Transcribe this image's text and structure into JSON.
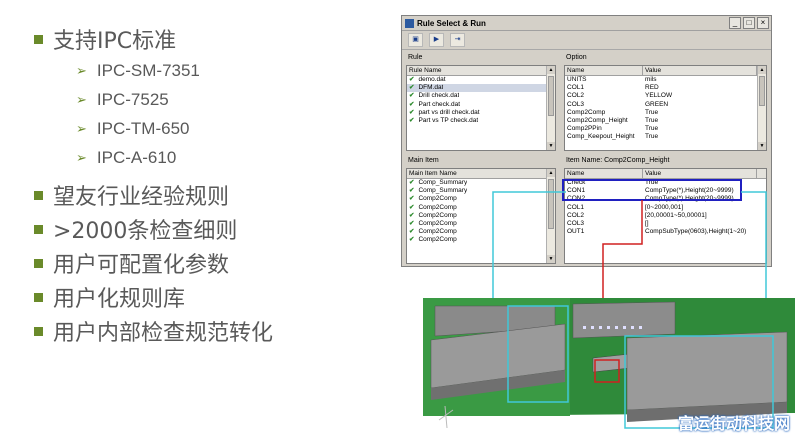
{
  "bullets": {
    "items": [
      {
        "text": "支持IPC标准",
        "sub": [
          "IPC-SM-7351",
          "IPC-7525",
          "IPC-TM-650",
          "IPC-A-610"
        ]
      },
      {
        "text": "望友行业经验规则"
      },
      {
        "text": ">2000条检查细则"
      },
      {
        "text": "用户可配置化参数"
      },
      {
        "text": "用户化规则库"
      },
      {
        "text": "用户内部检查规范转化"
      }
    ]
  },
  "window": {
    "title": "Rule Select & Run",
    "controls": {
      "minimize": "_",
      "maximize": "□",
      "close": "×"
    },
    "rule_panel": {
      "label": "Rule",
      "header": "Rule Name",
      "rows": [
        "demo.dat",
        "DFM.dat",
        "Drill check.dat",
        "Part check.dat",
        "part vs drill check.dat",
        "Part vs TP check.dat"
      ]
    },
    "option_panel": {
      "label": "Option",
      "headers": [
        "Name",
        "Value"
      ],
      "rows": [
        [
          "UNITS",
          "mils"
        ],
        [
          "COL1",
          "RED"
        ],
        [
          "COL2",
          "YELLOW"
        ],
        [
          "COL3",
          "GREEN"
        ],
        [
          "Comp2Comp",
          "True"
        ],
        [
          "Comp2Comp_Height",
          "True"
        ],
        [
          "Comp2PPin",
          "True"
        ],
        [
          "Comp_Keepout_Height",
          "True"
        ]
      ]
    },
    "main_item_panel": {
      "label": "Main Item",
      "header": "Main Item Name",
      "rows": [
        "Comp_Summary",
        "Comp_Summary",
        "Comp2Comp",
        "Comp2Comp",
        "Comp2Comp",
        "Comp2Comp",
        "Comp2Comp",
        "Comp2Comp"
      ]
    },
    "item_panel": {
      "label": "Item Name: Comp2Comp_Height",
      "headers": [
        "Name",
        "Value"
      ],
      "rows": [
        [
          "Check",
          "True"
        ],
        [
          "CON1",
          "CompType(*),Height(20~9999)"
        ],
        [
          "CON2",
          "CompType(*),Height(20~9999)"
        ],
        [
          "COL1",
          "[0~2000,001]"
        ],
        [
          "COL2",
          "[20,00001~50,00001]"
        ],
        [
          "COL3",
          "[]"
        ],
        [
          "OUT1",
          "CompSubType(0603),Height(1~20)"
        ]
      ]
    }
  },
  "watermark": "富运街动科技网",
  "colors": {
    "bullet": "#6a8a2a",
    "highlight_box": "#2020c0",
    "callout_cyan": "#40c8d8",
    "callout_red": "#d02020",
    "pcb_green": "#2f8a3a"
  }
}
